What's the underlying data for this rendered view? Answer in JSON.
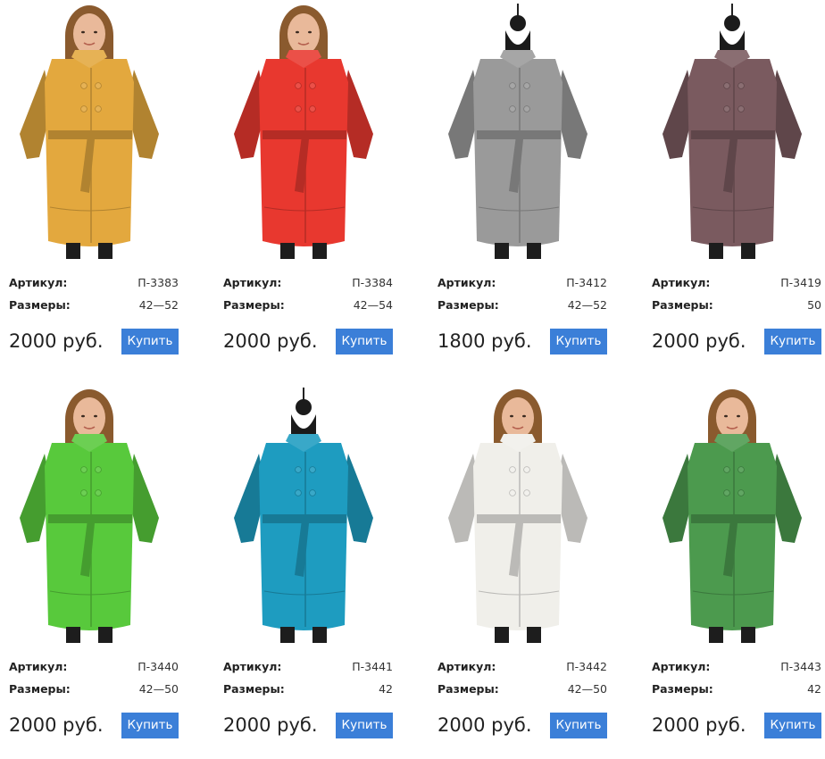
{
  "labels": {
    "article": "Артикул:",
    "sizes": "Размеры:"
  },
  "products": [
    {
      "article": "П-3383",
      "sizes": "42—52",
      "price": "2000 руб.",
      "buy": "Купить",
      "coat_color": "#E3A83E",
      "model": "woman"
    },
    {
      "article": "П-3384",
      "sizes": "42—54",
      "price": "2000 руб.",
      "buy": "Купить",
      "coat_color": "#E8382F",
      "model": "woman"
    },
    {
      "article": "П-3412",
      "sizes": "42—52",
      "price": "1800 руб.",
      "buy": "Купить",
      "coat_color": "#9A9A9A",
      "model": "mannequin"
    },
    {
      "article": "П-3419",
      "sizes": "50",
      "price": "2000 руб.",
      "buy": "Купить",
      "coat_color": "#7A5A5F",
      "model": "mannequin"
    },
    {
      "article": "П-3440",
      "sizes": "42—50",
      "price": "2000 руб.",
      "buy": "Купить",
      "coat_color": "#58C93C",
      "model": "woman"
    },
    {
      "article": "П-3441",
      "sizes": "42",
      "price": "2000 руб.",
      "buy": "Купить",
      "coat_color": "#1E9CC0",
      "model": "mannequin"
    },
    {
      "article": "П-3442",
      "sizes": "42—50",
      "price": "2000 руб.",
      "buy": "Купить",
      "coat_color": "#F0EFEA",
      "model": "woman"
    },
    {
      "article": "П-3443",
      "sizes": "42",
      "price": "2000 руб.",
      "buy": "Купить",
      "coat_color": "#4C9A4E",
      "model": "woman"
    }
  ]
}
